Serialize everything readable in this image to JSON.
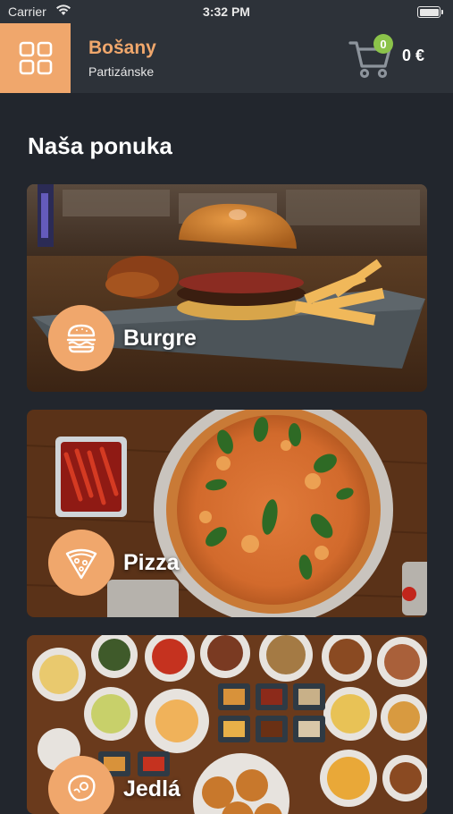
{
  "status_bar": {
    "carrier": "Carrier",
    "time": "3:32 PM"
  },
  "header": {
    "restaurant_name": "Bošany",
    "location": "Partizánske",
    "cart_count": "0",
    "cart_total": "0 €"
  },
  "section_title": "Naša ponuka",
  "categories": [
    {
      "label": "Burgre",
      "icon": "burger-icon"
    },
    {
      "label": "Pizza",
      "icon": "pizza-slice-icon"
    },
    {
      "label": "Jedlá",
      "icon": "steak-icon"
    }
  ],
  "colors": {
    "accent": "#f0a76c",
    "background": "#22262d",
    "header": "#2d3239",
    "badge": "#8bc34a"
  }
}
